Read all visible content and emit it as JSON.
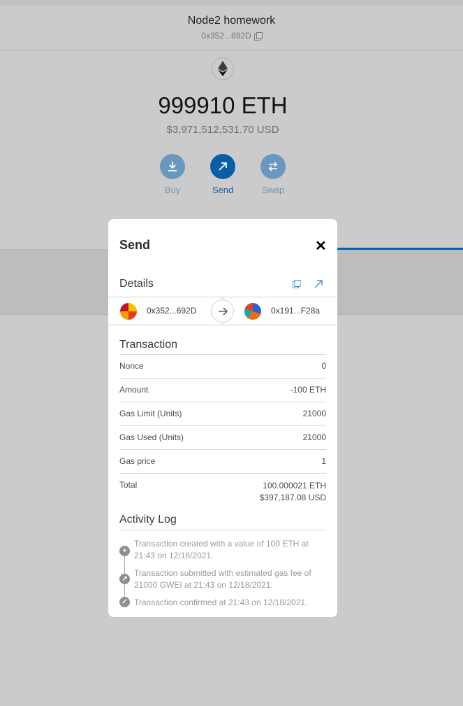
{
  "account": {
    "name": "Node2 homework",
    "address": "0x352...692D",
    "copy_icon": "copy-icon"
  },
  "wallet": {
    "balance": "999910 ETH",
    "fiat": "$3,971,512,531.70 USD",
    "actions": [
      {
        "label": "Buy",
        "icon": "download-icon",
        "color": "#6a97bf"
      },
      {
        "label": "Send",
        "icon": "arrow-up-right-icon",
        "color": "#0a5ea8"
      },
      {
        "label": "Swap",
        "icon": "swap-icon",
        "color": "#6a97bf"
      }
    ]
  },
  "modal": {
    "title": "Send",
    "close_icon": "close-icon",
    "details_title": "Details",
    "from_address": "0x352...692D",
    "to_address": "0x191...F28a",
    "transaction_title": "Transaction",
    "rows": [
      {
        "label": "Nonce",
        "value": "0"
      },
      {
        "label": "Amount",
        "value": "-100 ETH"
      },
      {
        "label": "Gas Limit (Units)",
        "value": "21000"
      },
      {
        "label": "Gas Used (Units)",
        "value": "21000"
      },
      {
        "label": "Gas price",
        "value": "1"
      }
    ],
    "total": {
      "label": "Total",
      "eth": "100.000021 ETH",
      "usd": "$397,187.08 USD"
    },
    "activity_title": "Activity Log",
    "activity": [
      {
        "icon": "plus-icon",
        "text": "Transaction created with a value of 100 ETH at 21:43 on 12/18/2021."
      },
      {
        "icon": "arrow-up-right-icon",
        "text": "Transaction submitted with estimated gas fee of 21000 GWEI at 21:43 on 12/18/2021."
      },
      {
        "icon": "check-icon",
        "text": "Transaction confirmed at 21:43 on 12/18/2021."
      }
    ]
  }
}
